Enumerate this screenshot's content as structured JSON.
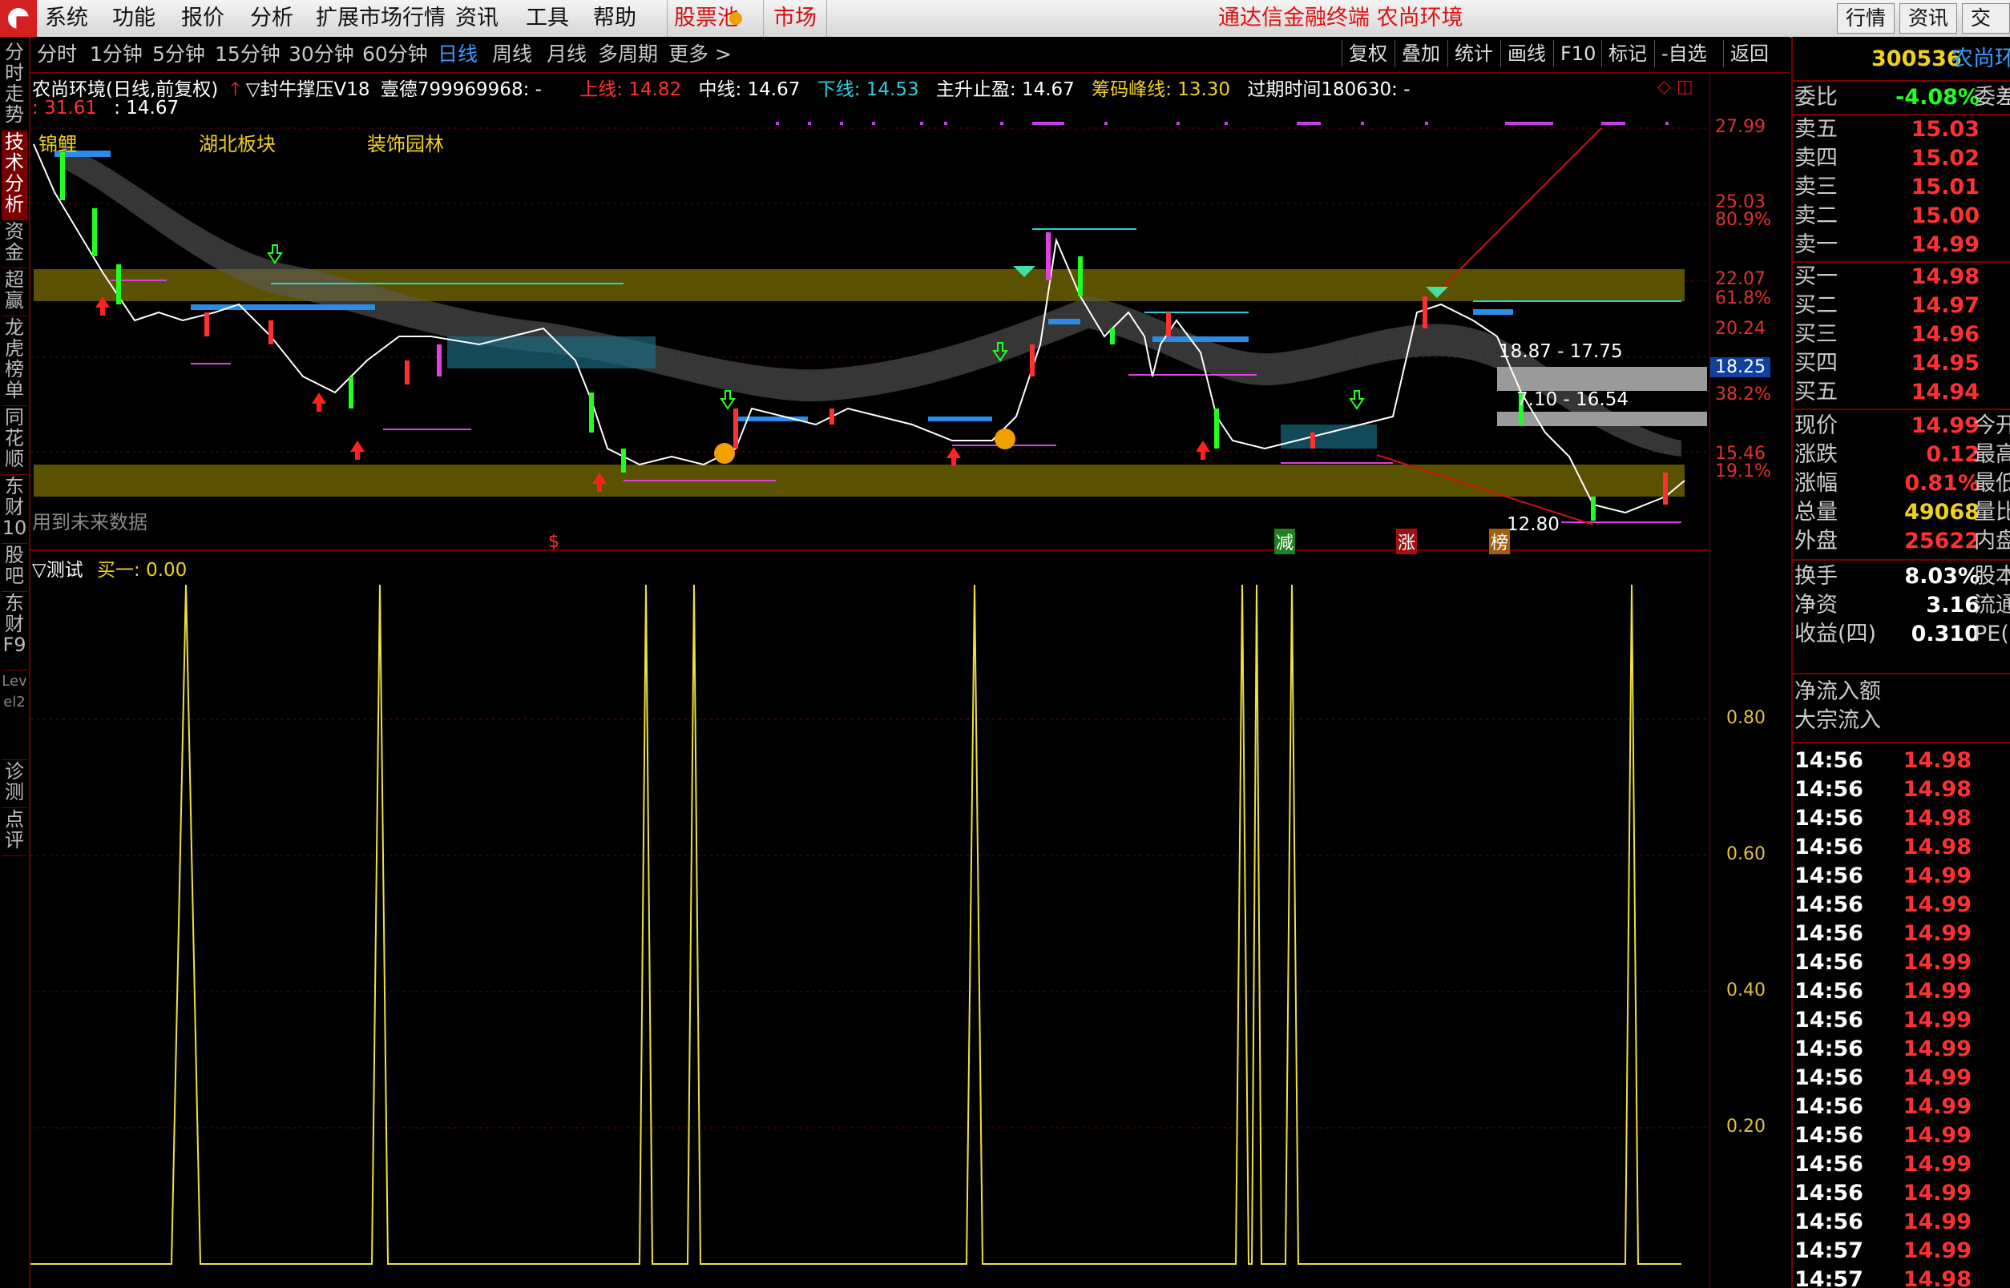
{
  "menu": {
    "items": [
      "系统",
      "功能",
      "报价",
      "分析",
      "扩展市场行情",
      "资讯",
      "工具",
      "帮助"
    ],
    "stock_pool": "股票池",
    "market": "市场",
    "title": "通达信金融终端 农尚环境",
    "right_buttons": [
      "行情",
      "资讯",
      "交易"
    ]
  },
  "left_tabs": [
    "分时走势",
    "技术分析",
    "资金",
    "超赢",
    "龙虎榜单",
    "同花顺",
    "东财10",
    "股吧",
    "东财F9",
    "Level2",
    "诊测",
    "点评"
  ],
  "periods": [
    "分时",
    "1分钟",
    "5分钟",
    "15分钟",
    "30分钟",
    "60分钟",
    "日线",
    "周线",
    "月线",
    "多周期",
    "更多 >"
  ],
  "tools": [
    "复权",
    "叠加",
    "统计",
    "画线",
    "F10",
    "标记",
    "-自选",
    "返回"
  ],
  "info": {
    "name": "农尚环境(日线,前复权)",
    "indicator": "▽封牛撑压V18",
    "code_label": "壹德799969968: -",
    "upper": "上线: 14.82",
    "middle": "中线: 14.67",
    "lower": "下线: 14.53",
    "stop": "主升止盈: 14.67",
    "chip": "筹码峰线: 13.30",
    "expire": "过期时间180630: -",
    "line2_a": ": 31.61",
    "line2_b": ": 14.67",
    "sectors": [
      "锦鲤",
      "湖北板块",
      "装饰园林"
    ],
    "future_note": "用到未来数据",
    "range_a": "18.87 - 17.75",
    "range_b": "7.10 - 16.54",
    "low_mark": "12.80",
    "signals": [
      "$",
      "减",
      "涨",
      "榜"
    ]
  },
  "price_axis": [
    "27.99",
    "25.03",
    "80.9%",
    "22.07",
    "61.8%",
    "20.24",
    "38.2%",
    "15.46",
    "19.1%"
  ],
  "current_price_tag": "18.25",
  "sub": {
    "title": "▽测试",
    "value": "买一: 0.00",
    "axis": [
      "0.80",
      "0.60",
      "0.40",
      "0.20"
    ]
  },
  "right": {
    "code": "300536",
    "name": "农尚环",
    "weibi": {
      "label": "委比",
      "value": "-4.08%",
      "extra": "委差"
    },
    "asks": [
      {
        "label": "卖五",
        "value": "15.03"
      },
      {
        "label": "卖四",
        "value": "15.02"
      },
      {
        "label": "卖三",
        "value": "15.01"
      },
      {
        "label": "卖二",
        "value": "15.00"
      },
      {
        "label": "卖一",
        "value": "14.99"
      }
    ],
    "bids": [
      {
        "label": "买一",
        "value": "14.98"
      },
      {
        "label": "买二",
        "value": "14.97"
      },
      {
        "label": "买三",
        "value": "14.96"
      },
      {
        "label": "买四",
        "value": "14.95"
      },
      {
        "label": "买五",
        "value": "14.94"
      }
    ],
    "stats": [
      {
        "label": "现价",
        "value": "14.99",
        "extra": "今开",
        "color": "red"
      },
      {
        "label": "涨跌",
        "value": "0.12",
        "extra": "最高",
        "color": "red"
      },
      {
        "label": "涨幅",
        "value": "0.81%",
        "extra": "最低",
        "color": "red"
      },
      {
        "label": "总量",
        "value": "49068",
        "extra": "量比",
        "color": "yellow"
      },
      {
        "label": "外盘",
        "value": "25622",
        "extra": "内盘",
        "color": "red"
      }
    ],
    "stats2": [
      {
        "label": "换手",
        "value": "8.03%",
        "extra": "股本"
      },
      {
        "label": "净资",
        "value": "3.16",
        "extra": "流通"
      },
      {
        "label": "收益(四)",
        "value": "0.310",
        "extra": "PE(动"
      }
    ],
    "flows": [
      "净流入额",
      "大宗流入"
    ],
    "ticks": [
      {
        "t": "14:56",
        "p": "14.98"
      },
      {
        "t": "14:56",
        "p": "14.98"
      },
      {
        "t": "14:56",
        "p": "14.98"
      },
      {
        "t": "14:56",
        "p": "14.98"
      },
      {
        "t": "14:56",
        "p": "14.99"
      },
      {
        "t": "14:56",
        "p": "14.99"
      },
      {
        "t": "14:56",
        "p": "14.99"
      },
      {
        "t": "14:56",
        "p": "14.99"
      },
      {
        "t": "14:56",
        "p": "14.99"
      },
      {
        "t": "14:56",
        "p": "14.99"
      },
      {
        "t": "14:56",
        "p": "14.99"
      },
      {
        "t": "14:56",
        "p": "14.99"
      },
      {
        "t": "14:56",
        "p": "14.99"
      },
      {
        "t": "14:56",
        "p": "14.99"
      },
      {
        "t": "14:56",
        "p": "14.99"
      },
      {
        "t": "14:56",
        "p": "14.99"
      },
      {
        "t": "14:56",
        "p": "14.99"
      },
      {
        "t": "14:57",
        "p": "14.99"
      },
      {
        "t": "14:57",
        "p": "14.98"
      }
    ]
  },
  "colors": {
    "red": "#ff3030",
    "green": "#20ff20",
    "yellow": "#f0d020",
    "band": "#5a5200",
    "frame": "#7a0000"
  }
}
